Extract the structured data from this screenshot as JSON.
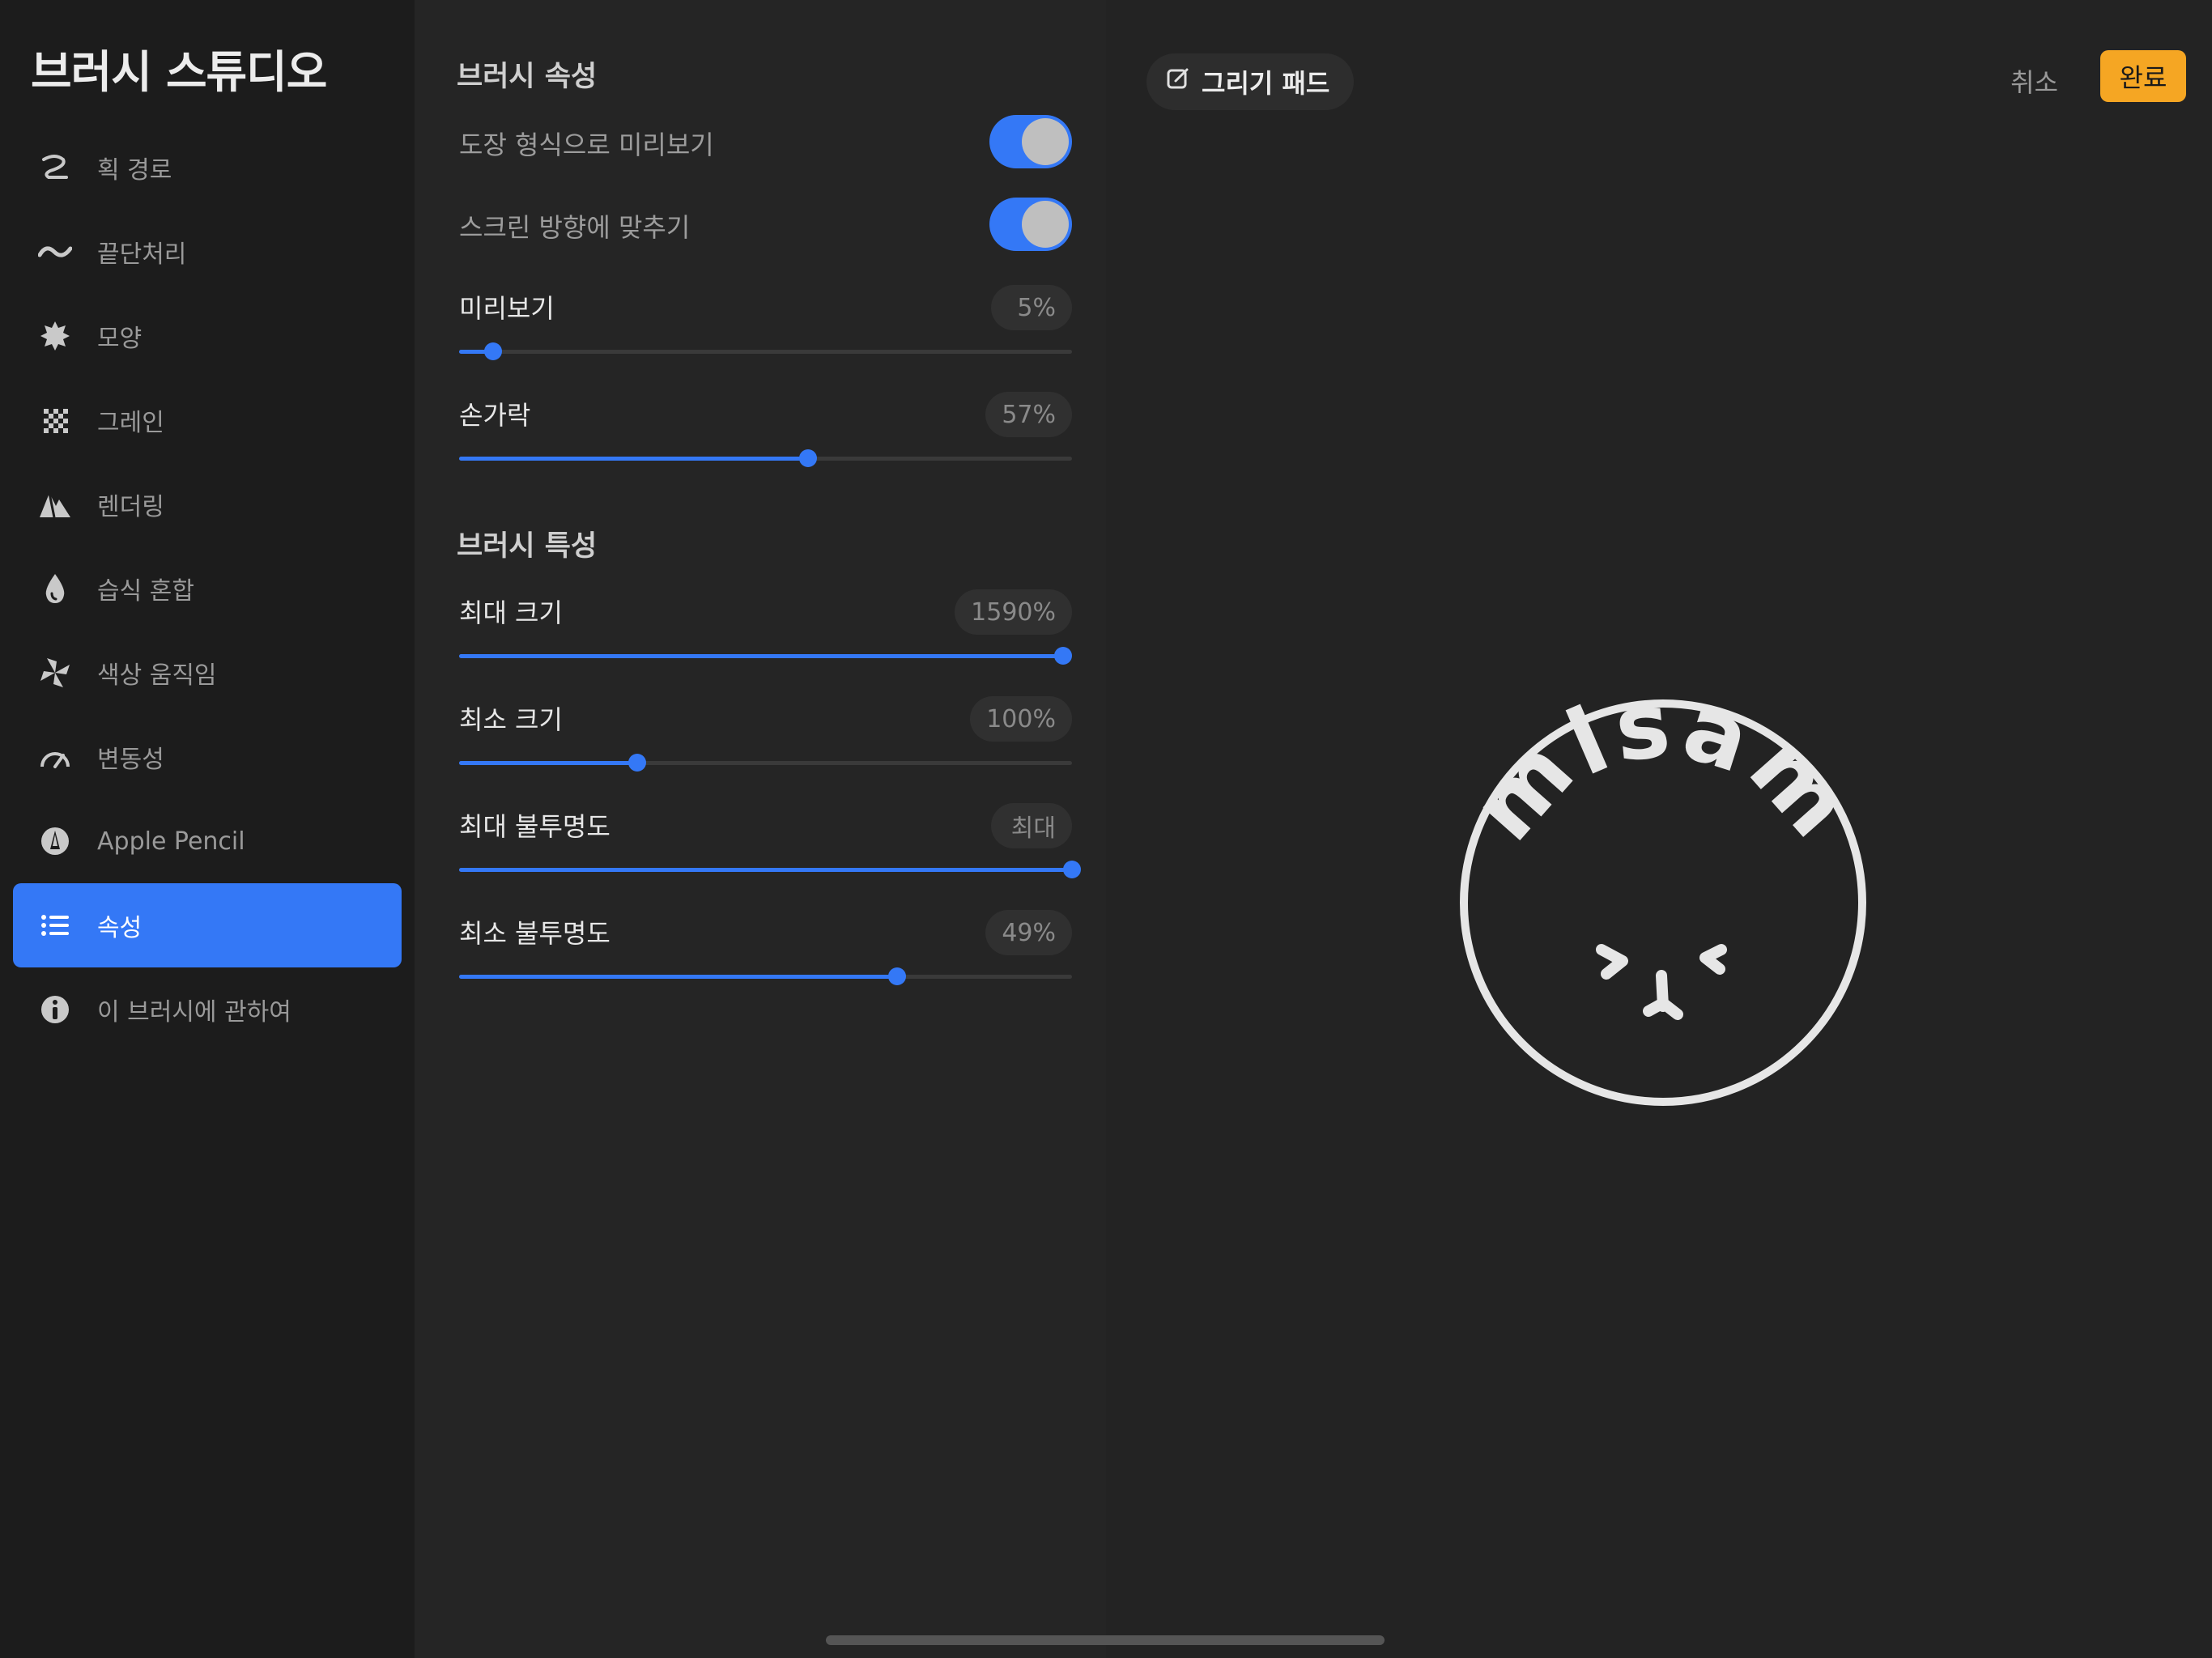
{
  "app_title": "브러시 스튜디오",
  "sidebar": {
    "items": [
      {
        "label": "획 경로",
        "icon": "stroke-path-icon"
      },
      {
        "label": "끝단처리",
        "icon": "taper-icon"
      },
      {
        "label": "모양",
        "icon": "shape-icon"
      },
      {
        "label": "그레인",
        "icon": "grain-icon"
      },
      {
        "label": "렌더링",
        "icon": "rendering-icon"
      },
      {
        "label": "습식 혼합",
        "icon": "wet-mix-icon"
      },
      {
        "label": "색상 움직임",
        "icon": "color-dynamics-icon"
      },
      {
        "label": "변동성",
        "icon": "dynamics-icon"
      },
      {
        "label": "Apple Pencil",
        "icon": "apple-pencil-icon"
      },
      {
        "label": "속성",
        "icon": "properties-icon",
        "active": true
      },
      {
        "label": "이 브러시에 관하여",
        "icon": "info-icon"
      }
    ]
  },
  "properties": {
    "section1_title": "브러시 속성",
    "toggles": [
      {
        "label": "도장 형식으로 미리보기",
        "on": true
      },
      {
        "label": "스크린 방향에 맞추기",
        "on": true
      }
    ],
    "sliders1": [
      {
        "label": "미리보기",
        "value": "5%",
        "level": 0.055
      },
      {
        "label": "손가락",
        "value": "57%",
        "level": 0.57
      }
    ],
    "section2_title": "브러시 특성",
    "sliders2": [
      {
        "label": "최대 크기",
        "value": "1590%",
        "level": 0.985
      },
      {
        "label": "최소 크기",
        "value": "100%",
        "level": 0.29
      },
      {
        "label": "최대 불투명도",
        "value": "최대",
        "level": 1.0
      },
      {
        "label": "최소 불투명도",
        "value": "49%",
        "level": 0.715
      }
    ]
  },
  "pad": {
    "chip_label": "그리기 패드",
    "cancel_label": "취소",
    "done_label": "완료",
    "stamp_text": "misam"
  },
  "colors": {
    "accent": "#3478f6",
    "done": "#f5a623"
  }
}
